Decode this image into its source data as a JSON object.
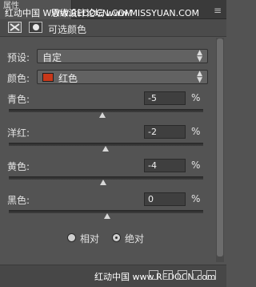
{
  "topbar": {
    "tab_label": "属性",
    "watermark_left": "红动中国 WWW.REDOCN.COM",
    "watermark_right": "思缘设计论坛 www.MISSYUAN.COM",
    "menu_icon": "panel-menu-icon"
  },
  "header": {
    "title": "可选颜色",
    "icon1": "adjustment-layer-icon",
    "icon2": "mask-icon"
  },
  "preset": {
    "label": "预设:",
    "value": "自定",
    "icon": "dropdown-arrows-icon"
  },
  "colors": {
    "label": "颜色:",
    "value": "红色",
    "swatch_color": "#c8381a",
    "icon": "dropdown-arrows-icon"
  },
  "sliders": [
    {
      "label": "青色:",
      "value": "-5",
      "unit": "%"
    },
    {
      "label": "洋红:",
      "value": "-2",
      "unit": "%"
    },
    {
      "label": "黄色:",
      "value": "-4",
      "unit": "%"
    },
    {
      "label": "黑色:",
      "value": "0",
      "unit": "%"
    }
  ],
  "method": {
    "options": [
      "相对",
      "绝对"
    ],
    "selected": "绝对"
  },
  "footer": {
    "watermark": "红动中国 www.REDOCN.com"
  }
}
